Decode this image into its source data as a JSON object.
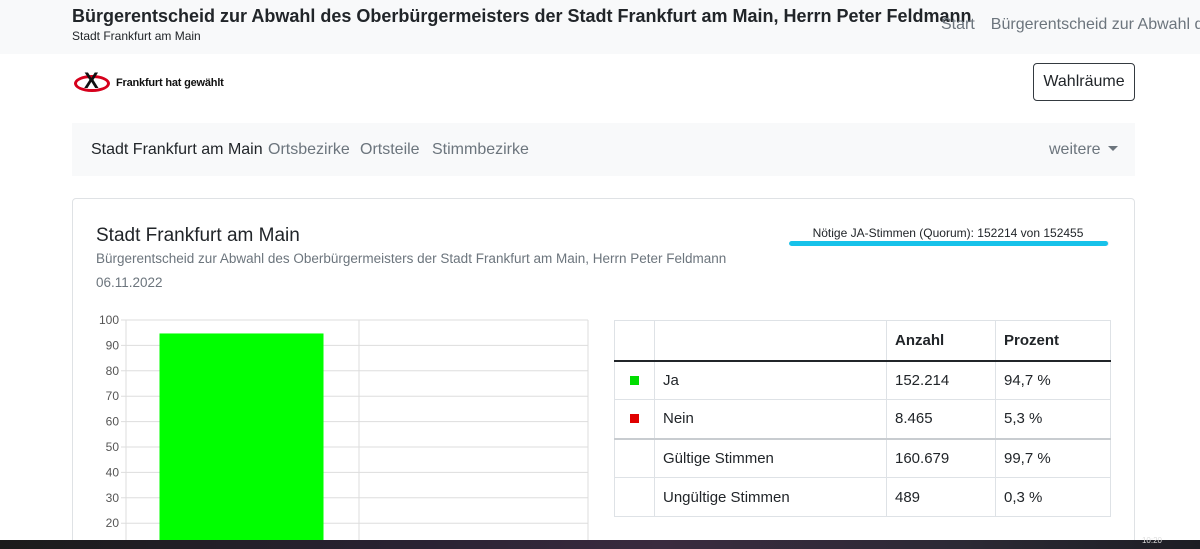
{
  "header": {
    "title": "Bürgerentscheid zur Abwahl des Oberbürgermeisters der Stadt Frankfurt am Main, Herrn Peter Feldmann",
    "subtitle": "Stadt Frankfurt am Main",
    "nav": [
      "Start",
      "Bürgerentscheid zur Abwahl des"
    ]
  },
  "logo": {
    "text": "Frankfurt hat gewählt",
    "mark": "X"
  },
  "wahlraeume_button": "Wahlräume",
  "subnav": {
    "items": [
      "Stadt Frankfurt am Main",
      "Ortsbezirke",
      "Ortsteile",
      "Stimmbezirke"
    ],
    "more": "weitere"
  },
  "card": {
    "title": "Stadt Frankfurt am Main",
    "subtitle": "Bürgerentscheid zur Abwahl des Oberbürgermeisters der Stadt Frankfurt am Main, Herrn Peter Feldmann",
    "date": "06.11.2022",
    "quorum": {
      "label": "Nötige JA-Stimmen (Quorum): 152214 von 152455",
      "fraction": 0.998
    }
  },
  "chart_data": {
    "type": "bar",
    "categories": [
      "Ja",
      "Nein"
    ],
    "values": [
      94.7,
      5.3
    ],
    "colors": [
      "#00ff00",
      "#e00000"
    ],
    "ylim": [
      0,
      100
    ],
    "yticks": [
      20,
      30,
      40,
      50,
      60,
      70,
      80,
      90,
      100
    ],
    "grid": true
  },
  "table": {
    "headers": [
      "",
      "",
      "Anzahl",
      "Prozent"
    ],
    "rows": [
      {
        "color": "#00dd00",
        "label": "Ja",
        "count": "152.214",
        "percent": "94,7 %"
      },
      {
        "color": "#e00000",
        "label": "Nein",
        "count": "8.465",
        "percent": "5,3 %"
      },
      {
        "color": "",
        "label": "Gültige Stimmen",
        "count": "160.679",
        "percent": "99,7 %"
      },
      {
        "color": "",
        "label": "Ungültige Stimmen",
        "count": "489",
        "percent": "0,3 %"
      }
    ]
  },
  "taskbar": {
    "clock": "10:20"
  }
}
